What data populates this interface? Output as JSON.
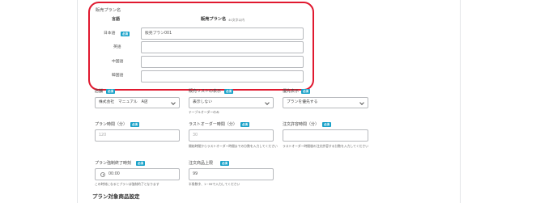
{
  "plan_name": {
    "section_label": "販売プラン名",
    "header_language": "言語",
    "header_plan_name": "販売プラン名",
    "header_char_note": "40文字以内",
    "required_badge": "必須",
    "rows": [
      {
        "language": "日本語",
        "value": "販売プラン001",
        "required": true
      },
      {
        "language": "英語",
        "value": "",
        "required": false
      },
      {
        "language": "中国語",
        "value": "",
        "required": false
      },
      {
        "language": "韓国語",
        "value": "",
        "required": false
      }
    ]
  },
  "fields": {
    "store": {
      "label": "店舗",
      "value": "株式会社　マニュアル　A店"
    },
    "sales_list_display": {
      "label": "販売リストの表示",
      "value": "表示しない",
      "help": "テーブルオーダーのみ"
    },
    "priority_display": {
      "label": "優先表示",
      "value": "プランを優先する"
    },
    "plan_time": {
      "label": "プラン時間（分）",
      "placeholder": "120"
    },
    "last_order_time": {
      "label": "ラストオーダー時間（分）",
      "placeholder": "30",
      "help": "開始時間からラストオーダー時間までの分数を入力してください"
    },
    "order_allowed_time": {
      "label": "注文許容時間（分）",
      "placeholder": "",
      "help": "ラストオーダー時間後の注文許容する分数を入力してください"
    },
    "forced_end_time": {
      "label": "プラン強制終了時刻",
      "value": "00:00",
      "help": "この時刻になるとプランは強制的了となります"
    },
    "order_limit": {
      "label": "注文商品上限",
      "value": "99",
      "help": "半角数字、1~99で入力してください"
    }
  },
  "next_section_title": "プラン対象商品設定",
  "colors": {
    "accent": "#1aa2c9",
    "highlight": "#e0192f",
    "border": "#b7b9bd"
  }
}
